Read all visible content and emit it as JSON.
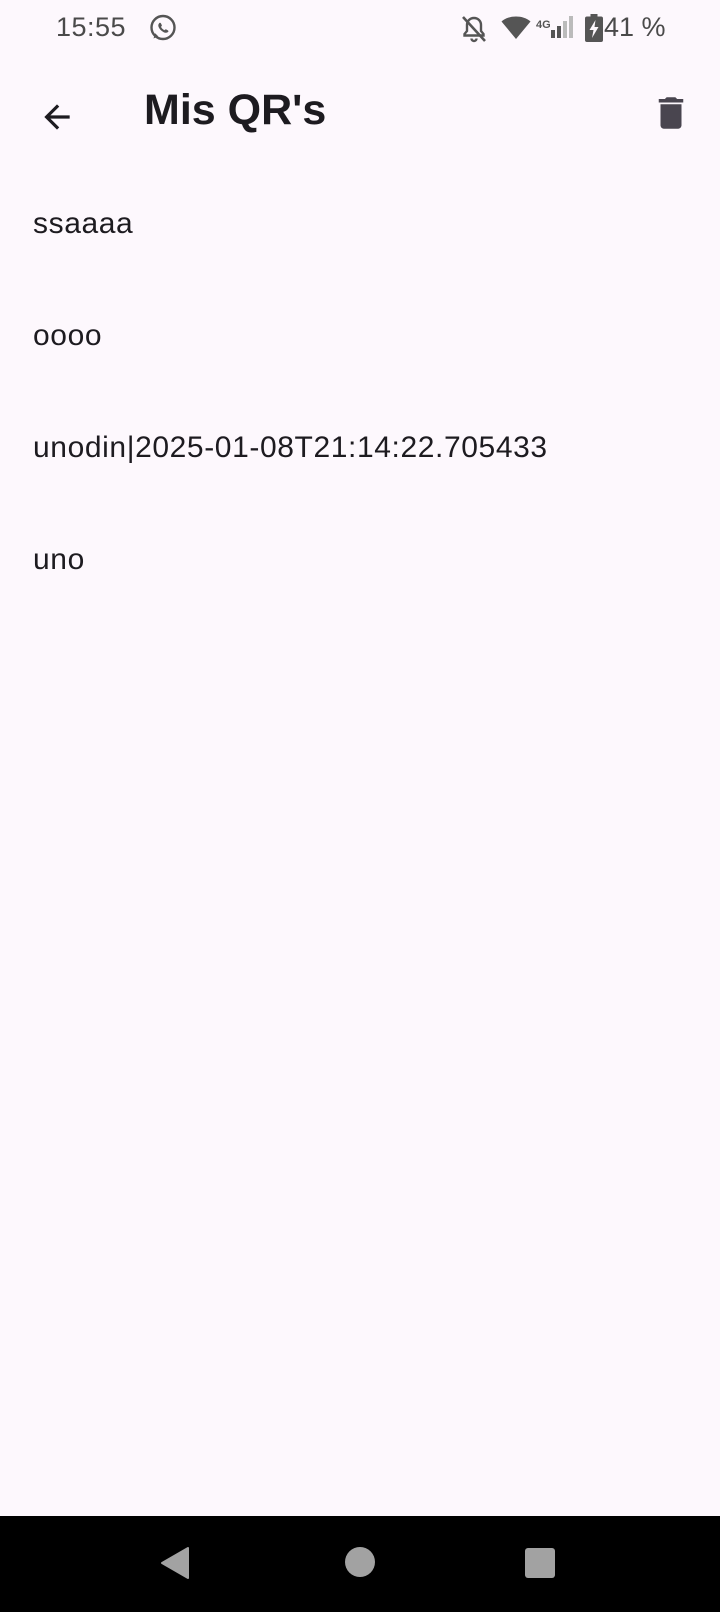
{
  "status_bar": {
    "time": "15:55",
    "network_type": "4G",
    "battery_percent": "41 %",
    "icons": [
      "whatsapp-icon",
      "notifications-off-icon",
      "wifi-icon",
      "cell-signal-icon",
      "battery-charging-icon"
    ]
  },
  "app_bar": {
    "title": "Mis QR's",
    "icons": [
      "arrow-back-icon",
      "delete-icon"
    ]
  },
  "qr_list": {
    "items": [
      {
        "text": "ssaaaa"
      },
      {
        "text": "oooo"
      },
      {
        "text": "unodin|2025-01-08T21:14:22.705433"
      },
      {
        "text": "uno"
      }
    ]
  },
  "nav_bar": {
    "icons": [
      "nav-back-icon",
      "nav-home-icon",
      "nav-recents-icon"
    ]
  },
  "colors": {
    "background": "#fdf8fd",
    "text": "#1d1b20",
    "status_text": "#4a4a4a",
    "nav_bar": "#000000",
    "nav_buttons": "#a2a2a2"
  }
}
